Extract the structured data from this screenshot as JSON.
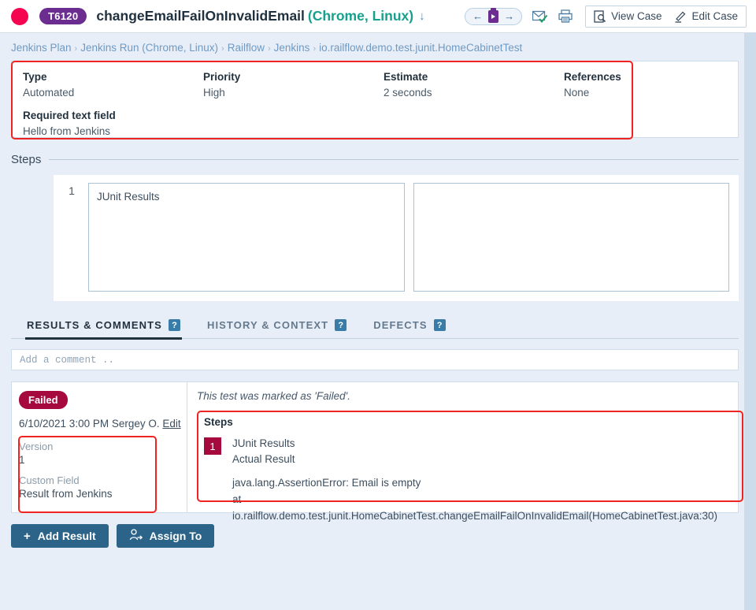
{
  "header": {
    "status_icon": "failed-status-dot",
    "status_color": "#f5054f",
    "case_id": "T6120",
    "case_id_color": "#6b2d8f",
    "title": "changeEmailFailOnInvalidEmail",
    "environment": "(Chrome, Linux)",
    "environment_color": "#17a08c",
    "download_icon": "↓",
    "nav": {
      "prev_icon": "←",
      "next_icon": "→",
      "clipboard_icon": "clipboard-icon"
    },
    "subscribe_icon": "envelope-check-icon",
    "print_icon": "printer-icon",
    "view_case_label": "View Case",
    "edit_case_label": "Edit Case"
  },
  "breadcrumb": {
    "items": [
      {
        "label": "Jenkins Plan"
      },
      {
        "label": "Jenkins Run (Chrome, Linux)"
      },
      {
        "label": "Railflow"
      },
      {
        "label": "Jenkins"
      },
      {
        "label": "io.railflow.demo.test.junit.HomeCabinetTest"
      }
    ],
    "separator": "›"
  },
  "details": {
    "fields": [
      {
        "label": "Type",
        "value": "Automated"
      },
      {
        "label": "Priority",
        "value": "High"
      },
      {
        "label": "Estimate",
        "value": "2 seconds"
      },
      {
        "label": "References",
        "value": "None"
      }
    ],
    "extra": {
      "label": "Required text field",
      "value": "Hello from Jenkins"
    },
    "highlight_color": "#ef2420"
  },
  "steps_section": {
    "title": "Steps",
    "rows": [
      {
        "number": "1",
        "step": "JUnit Results",
        "expected": ""
      }
    ]
  },
  "tabs": [
    {
      "label": "RESULTS & COMMENTS",
      "help": "?",
      "active": true
    },
    {
      "label": "HISTORY & CONTEXT",
      "help": "?",
      "active": false
    },
    {
      "label": "DEFECTS",
      "help": "?",
      "active": false
    }
  ],
  "comment": {
    "placeholder": "Add a comment .."
  },
  "result": {
    "status": "Failed",
    "status_color": "#a6093d",
    "timestamp": "6/10/2021 3:00 PM",
    "author": "Sergey O.",
    "edit_label": "Edit",
    "custom_fields": [
      {
        "label": "Version",
        "value": "1"
      },
      {
        "label": "Custom Field",
        "value": "Result from Jenkins"
      }
    ],
    "marked_note": "This test was marked as 'Failed'.",
    "steps_title": "Steps",
    "step_number": "1",
    "step_name": "JUnit Results",
    "actual_result_label": "Actual Result",
    "trace_line_1": "java.lang.AssertionError: Email is empty",
    "trace_line_2": "at io.railflow.demo.test.junit.HomeCabinetTest.changeEmailFailOnInvalidEmail(HomeCabinetTest.java:30)"
  },
  "footer": {
    "add_result_label": "Add Result",
    "add_result_icon": "+",
    "assign_to_label": "Assign To",
    "assign_to_icon": "person-arrow-icon"
  }
}
